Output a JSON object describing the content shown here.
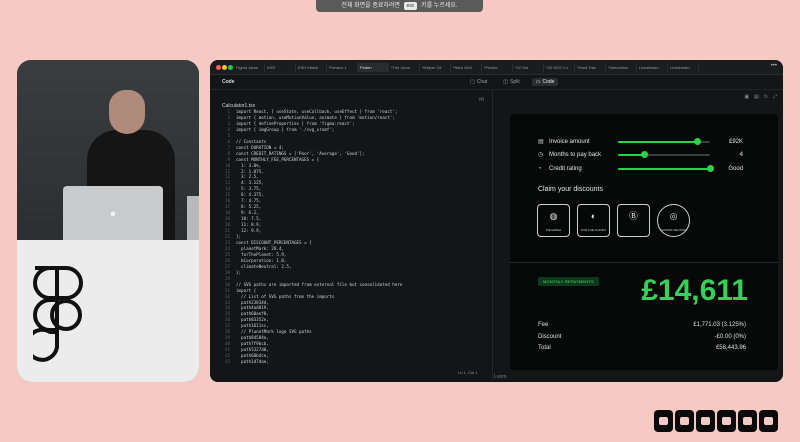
{
  "toast": {
    "text_before": "전체 화면을 종료하려면",
    "key": "esc",
    "text_after": "키를 누르세요."
  },
  "colors": {
    "accent_green": "#2bd14a",
    "amount_green": "#34d058",
    "page_background": "#f6c9c5",
    "window_background": "#101112"
  },
  "browser": {
    "tabs": [
      {
        "label": "Figma Jams",
        "active": false
      },
      {
        "label": "KKR",
        "active": false
      },
      {
        "label": "ESH Match",
        "active": false
      },
      {
        "label": "Preview 1",
        "active": false
      },
      {
        "label": "Peden",
        "active": true
      },
      {
        "label": "*Trel Jsom",
        "active": false
      },
      {
        "label": "*Helper Gil",
        "active": false
      },
      {
        "label": "*Nitro Grid",
        "active": false
      },
      {
        "label": "*Fincko",
        "active": false
      },
      {
        "label": "*22 Sol",
        "active": false
      },
      {
        "label": "*33 SVG Co",
        "active": false
      },
      {
        "label": "*Hard Trac",
        "active": false
      },
      {
        "label": "*Interaction",
        "active": false
      },
      {
        "label": "Livestream",
        "active": false
      },
      {
        "label": "Livestream",
        "active": false
      }
    ]
  },
  "toolbar": {
    "doc_title": "Code",
    "view_tabs": [
      {
        "label": "Chat",
        "icon": "chat-icon",
        "active": false
      },
      {
        "label": "Split",
        "icon": "split-icon",
        "active": false
      },
      {
        "label": "Code",
        "icon": "code-icon",
        "active": true
      }
    ]
  },
  "editor": {
    "filename": "Calculator1.tsx",
    "position": "{#}",
    "status": "Ln 1, Col 1",
    "lines": [
      "import React, { useState, useCallback, useEffect } from 'react';",
      "import { motion, useMotionValue, animate } from 'motion/react';",
      "import { defineProperties } from 'figma:react';",
      "import { imgGroup } from './svg_xrxmf';",
      "",
      "// Constants",
      "const DURATION = 4;",
      "const CREDIT_RATINGS = ['Poor', 'Average', 'Good'];",
      "const MONTHLY_FEE_PERCENTAGES = {",
      "  1: 3.0%,",
      "  2: 1.875,",
      "  3: 2.5,",
      "  4: 3.125,",
      "  5: 3.75,",
      "  6: 4.375,",
      "  7: 4.75,",
      "  8: 5.25,",
      "  9: 6.2,",
      "  10: 7.5,",
      "  11: 8.9,",
      "  12: 9.9,",
      "};",
      "const DISCOUNT_PERCENTAGES = {",
      "  planetMark: 28.4,",
      "  forThePlanet: 5.9,",
      "  bCorporation: 1.0,",
      "  climateNeutral: 2.5,",
      "};",
      "",
      "// SVG paths are imported from external file but consolidated here",
      "import {",
      "  // List of SVG paths from the imports",
      "  path23834d,",
      "  path4ad019,",
      "  path60aef0,",
      "  path83352e,",
      "  path1611sc,",
      "  // PlanetMark logo SVG paths",
      "  path84584a,",
      "  path7f9bcb,",
      "  path5327d0,",
      "  path60b4ce,",
      "  path1d7dae,"
    ]
  },
  "preview": {
    "icons": [
      "preview-icon",
      "devices-icon",
      "refresh-icon",
      "fullscreen-icon"
    ],
    "sliders": [
      {
        "icon": "document-icon",
        "label": "Invoice amount",
        "value": "£92K",
        "fraction": 0.86
      },
      {
        "icon": "clock-icon",
        "label": "Months to pay back",
        "value": "4",
        "fraction": 0.29
      },
      {
        "icon": "gauge-icon",
        "label": "Credit rating",
        "value": "Good",
        "fraction": 1.0
      }
    ],
    "claim_title": "Claim your discounts",
    "badges": [
      {
        "mark": "◍",
        "caption": "PlanetMark",
        "shape": "square"
      },
      {
        "mark": "◐",
        "caption": "FOR THE PLANET",
        "shape": "square"
      },
      {
        "mark": "Ⓑ",
        "caption": "",
        "shape": "square"
      },
      {
        "mark": "◎",
        "caption": "CLIMATE NEUTRAL",
        "shape": "round"
      }
    ],
    "repayments_label": "MONTHLY REPAYMENTS",
    "amount": "£14,611",
    "summary": [
      {
        "label": "Fee",
        "value": "£1,771.03 (3.125%)"
      },
      {
        "label": "Discount",
        "value": "-£0.00 (0%)"
      },
      {
        "label": "Total",
        "value": "£58,443.96"
      }
    ]
  },
  "window_bottom_text": "Loom",
  "brand": "CONFIG"
}
